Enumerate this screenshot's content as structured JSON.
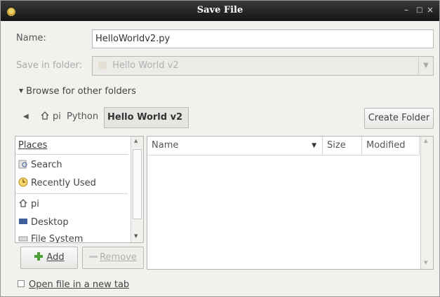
{
  "window": {
    "title": "Save File"
  },
  "form": {
    "name_label": "Name:",
    "name_value": "HelloWorldv2.py",
    "save_in_label": "Save in folder:",
    "save_in_value": "Hello World v2"
  },
  "browse": {
    "label": "Browse for other folders"
  },
  "breadcrumb": {
    "items": [
      "pi",
      "Python",
      "Hello World v2"
    ],
    "create_folder": "Create Folder"
  },
  "places": {
    "header": "Places",
    "items": [
      {
        "label": "Search",
        "icon": "search-icon"
      },
      {
        "label": "Recently Used",
        "icon": "clock-icon"
      },
      {
        "label": "pi",
        "icon": "home-icon"
      },
      {
        "label": "Desktop",
        "icon": "desktop-icon"
      },
      {
        "label": "File System",
        "icon": "drive-icon"
      }
    ],
    "add_label": "Add",
    "remove_label": "Remove"
  },
  "files": {
    "columns": [
      "Name",
      "Size",
      "Modified"
    ]
  },
  "options": {
    "open_new_tab_label": "Open file in a new tab",
    "open_new_tab_checked": false
  }
}
